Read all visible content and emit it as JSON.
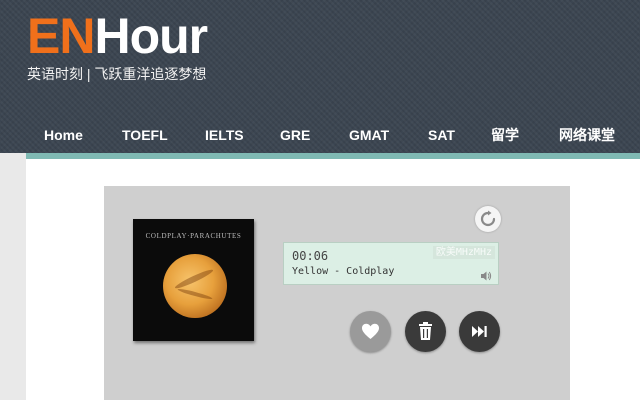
{
  "site": {
    "logo_en": "EN",
    "logo_hour": "Hour",
    "tagline": "英语时刻 | 飞跃重洋追逐梦想"
  },
  "nav": {
    "items": [
      {
        "label": "Home"
      },
      {
        "label": "TOEFL"
      },
      {
        "label": "IELTS"
      },
      {
        "label": "GRE"
      },
      {
        "label": "GMAT"
      },
      {
        "label": "SAT"
      },
      {
        "label": "留学"
      },
      {
        "label": "网络课堂"
      }
    ]
  },
  "player": {
    "album_text": "COLDPLAY·PARACHUTES",
    "time": "00:06",
    "track": "Yellow - Coldplay",
    "channel": "欧美MHzMHz",
    "icons": {
      "refresh": "refresh-icon",
      "volume": "volume-icon",
      "love": "heart-icon",
      "trash": "trash-icon",
      "next": "skip-next-icon"
    }
  },
  "colors": {
    "header_bg": "#3b4551",
    "logo_accent": "#f0701b",
    "teal_bar": "#7fb9b3",
    "player_bg": "#cfcfcf",
    "screen_bg": "#dcefe5"
  }
}
